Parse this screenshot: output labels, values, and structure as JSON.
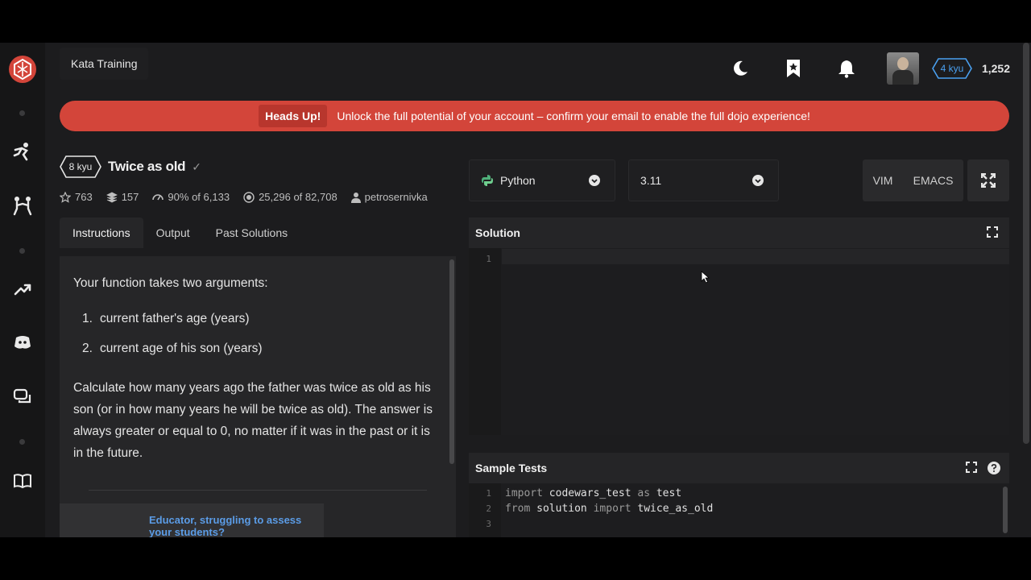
{
  "breadcrumb": "Kata Training",
  "user": {
    "rank": "4 kyu",
    "honor": "1,252"
  },
  "banner": {
    "tag": "Heads Up!",
    "message": "Unlock the full potential of your account – confirm your email to enable the full dojo experience!"
  },
  "kata": {
    "rank": "8 kyu",
    "title": "Twice as old",
    "stats": {
      "stars": "763",
      "collections": "157",
      "satisfaction": "90%",
      "satisfaction_of": "of 6,133",
      "completed": "25,296",
      "completed_of": "of 82,708",
      "author": "petrosernivka"
    }
  },
  "tabs": [
    "Instructions",
    "Output",
    "Past Solutions"
  ],
  "instructions": {
    "intro": "Your function takes two arguments:",
    "items": [
      {
        "num": "1.",
        "text": "current father's age (years)"
      },
      {
        "num": "2.",
        "text": "current age of his son (years)"
      }
    ],
    "body": "Calculate how many years ago the father was twice as old as his son (or in how many years he will be twice as old). The answer is always greater or equal to 0, no matter if it was in the past or it is in the future.",
    "educator": "Educator, struggling to assess your students?"
  },
  "language": "Python",
  "version": "3.11",
  "modes": [
    "VIM",
    "EMACS"
  ],
  "solution": {
    "title": "Solution",
    "line_numbers": [
      "1"
    ]
  },
  "sample_tests": {
    "title": "Sample Tests",
    "lines": [
      {
        "num": "1",
        "kw1": "import",
        "mid": " codewars_test ",
        "kw2": "as",
        "tail": " test"
      },
      {
        "num": "2",
        "kw1": "from",
        "mid": " solution ",
        "kw2": "import",
        "tail": " twice_as_old"
      },
      {
        "num": "3",
        "kw1": "",
        "mid": "",
        "kw2": "",
        "tail": ""
      }
    ]
  },
  "colors": {
    "brand": "#d3453a",
    "rank_blue": "#4aa0f0",
    "link": "#5b9ce6"
  }
}
